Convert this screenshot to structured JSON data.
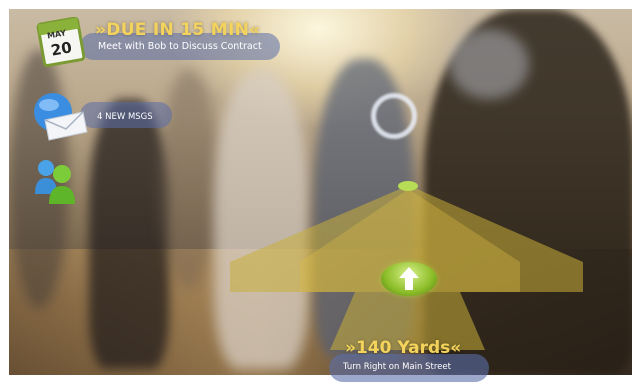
{
  "notifications": {
    "calendar": {
      "icon": "calendar-icon",
      "month": "MAY",
      "day": "20",
      "title": "»DUE IN 15 MIN«",
      "subtitle": "Meet with Bob to Discuss Contract"
    },
    "messages": {
      "icon": "mail-globe-icon",
      "label": "4 NEW MSGS"
    },
    "contacts": {
      "icon": "people-icon"
    }
  },
  "navigation": {
    "icon": "up-arrow-icon",
    "distance": "»140 Yards«",
    "instruction": "Turn Right on Main Street"
  },
  "colors": {
    "accent": "#f4d35c",
    "pill": "#5a6eaa",
    "path": "#c9ae3a",
    "arrow": "#8cbd28"
  }
}
